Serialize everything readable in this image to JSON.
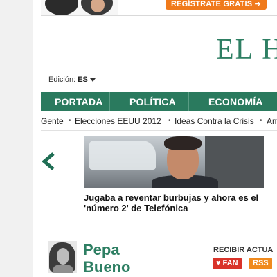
{
  "ad": {
    "cta_label": "REGÍSTRATE GRATIS ➔"
  },
  "header": {
    "logo_text": "EL H",
    "edition_label": "Edición:",
    "edition_value": "ES"
  },
  "main_nav": {
    "items": [
      {
        "label": "PORTADA"
      },
      {
        "label": "POLÍTICA"
      },
      {
        "label": "ECONOMÍA"
      }
    ]
  },
  "sub_nav": {
    "items": [
      {
        "label": "Gente"
      },
      {
        "label": "Elecciones EEUU 2012"
      },
      {
        "label": "Ideas Contra la Crisis"
      },
      {
        "label": "Am"
      }
    ]
  },
  "carousel": {
    "headline": "Jugaba a reventar burbujas y ahora es el 'número 2' de Telefónica"
  },
  "columnist": {
    "first_name": "Pepa",
    "last_name": "Bueno"
  },
  "subscribe": {
    "label": "RECIBIR ACTUA",
    "fan_label": "FAN",
    "rss_label": "RSS"
  },
  "colors": {
    "brand_green": "#2a7a5e",
    "cta_orange": "#f07a1b",
    "fan_red": "#d9332a",
    "rss_orange": "#f08a1d"
  }
}
